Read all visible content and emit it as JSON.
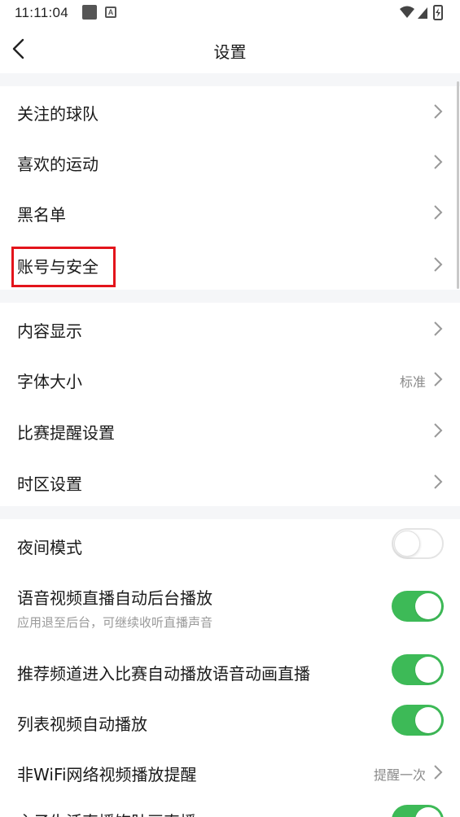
{
  "status_bar": {
    "time": "11:11:04",
    "notif_icon_letter": "A"
  },
  "nav": {
    "title": "设置"
  },
  "rows": {
    "followed_teams": "关注的球队",
    "liked_sports": "喜欢的运动",
    "blacklist": "黑名单",
    "account_security": "账号与安全",
    "content_display": "内容显示",
    "font_size": "字体大小",
    "font_size_value": "标准",
    "match_reminder": "比赛提醒设置",
    "timezone": "时区设置",
    "night_mode": "夜间模式",
    "audio_video_bg": "语音视频直播自动后台播放",
    "audio_video_bg_sub": "应用退至后台，可继续收听直播声音",
    "recommend_autoplay": "推荐频道进入比赛自动播放语音动画直播",
    "list_autoplay": "列表视频自动播放",
    "non_wifi_reminder": "非WiFi网络视频播放提醒",
    "non_wifi_reminder_value": "提醒一次",
    "partial_row": "主子生活直播饰肚画直播"
  },
  "toggles": {
    "night_mode": false,
    "audio_video_bg": true,
    "recommend_autoplay": true,
    "list_autoplay": true,
    "partial_row": true
  },
  "colors": {
    "toggle_on": "#3dba57",
    "highlight": "#e3141b",
    "section_gap": "#f5f6f8"
  }
}
